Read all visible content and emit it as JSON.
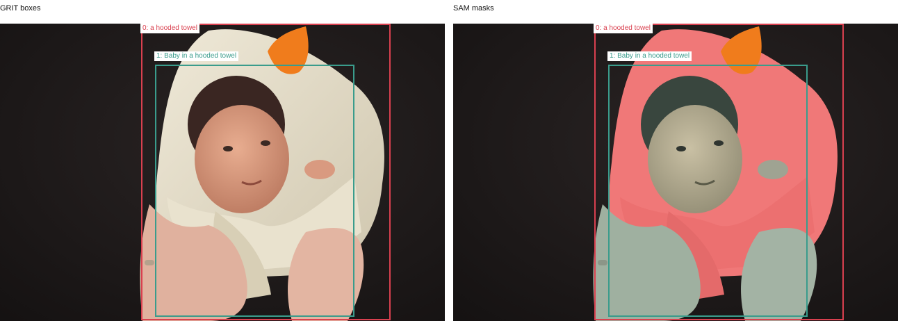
{
  "panels": [
    {
      "title": "GRIT boxes",
      "mode": "boxes"
    },
    {
      "title": "SAM masks",
      "mode": "masks"
    }
  ],
  "annotations": [
    {
      "label": "0: a hooded towel",
      "color": "#d9404f"
    },
    {
      "label": "1: Baby in a hooded towel",
      "color": "#3a9c8c"
    }
  ]
}
